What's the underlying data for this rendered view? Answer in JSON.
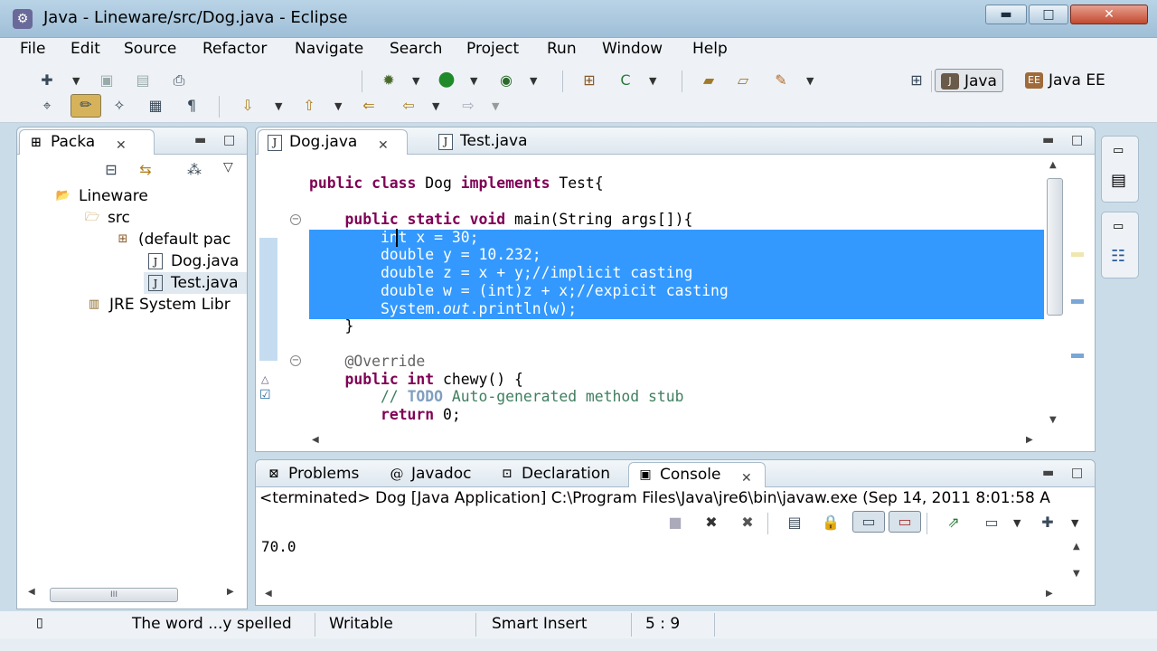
{
  "window": {
    "title": "Java - Lineware/src/Dog.java - Eclipse",
    "min_glyph": "▬",
    "max_glyph": "□",
    "close_glyph": "✕"
  },
  "menu": [
    "File",
    "Edit",
    "Source",
    "Refactor",
    "Navigate",
    "Search",
    "Project",
    "Run",
    "Window",
    "Help"
  ],
  "perspectives": {
    "java": "Java",
    "java_ee": "Java EE"
  },
  "package_explorer": {
    "tab_label": "Packa",
    "tree": [
      {
        "label": "Lineware",
        "icon": "project-folder-icon"
      },
      {
        "label": "src",
        "icon": "source-folder-icon"
      },
      {
        "label": "(default pac",
        "icon": "package-icon"
      },
      {
        "label": "Dog.java",
        "icon": "java-file-icon"
      },
      {
        "label": "Test.java",
        "icon": "java-file-icon"
      },
      {
        "label": "JRE System Libr",
        "icon": "library-icon"
      }
    ],
    "hscroll_thumb": "III"
  },
  "editor": {
    "tabs": [
      {
        "label": "Dog.java",
        "active": true
      },
      {
        "label": "Test.java",
        "active": false
      }
    ],
    "lines": {
      "l1_kw": "public class",
      "l1_rest": " Dog ",
      "l1_kw2": "implements",
      "l1_rest2": " Test{",
      "l2_kw": "public static void",
      "l2_rest": " main(String args[]){",
      "l3": "        int x = 30;",
      "l4": "        double y = 10.232;",
      "l5": "        double z = x + y;//implicit casting",
      "l6": "        double w = (int)z + x;//expicit casting",
      "l7_a": "        System.",
      "l7_b": "out",
      "l7_c": ".println(w);",
      "l8": "    }",
      "l9": "    @Override",
      "l10_kw": "public int",
      "l10_rest": " chewy() {",
      "l11_a": "        // ",
      "l11_todo": "TODO",
      "l11_b": " Auto-generated method stub",
      "l12_kw": "return",
      "l12_rest": " 0;"
    }
  },
  "console": {
    "tabs": [
      {
        "label": "Problems",
        "active": false
      },
      {
        "label": "Javadoc",
        "active": false
      },
      {
        "label": "Declaration",
        "active": false
      },
      {
        "label": "Console",
        "active": true
      }
    ],
    "header": "<terminated> Dog [Java Application] C:\\Program Files\\Java\\jre6\\bin\\javaw.exe (Sep 14, 2011 8:01:58 A",
    "output": "70.0"
  },
  "status": {
    "message": "The word ...y spelled",
    "mode": "Writable",
    "insert": "Smart Insert",
    "position": "5 : 9"
  }
}
